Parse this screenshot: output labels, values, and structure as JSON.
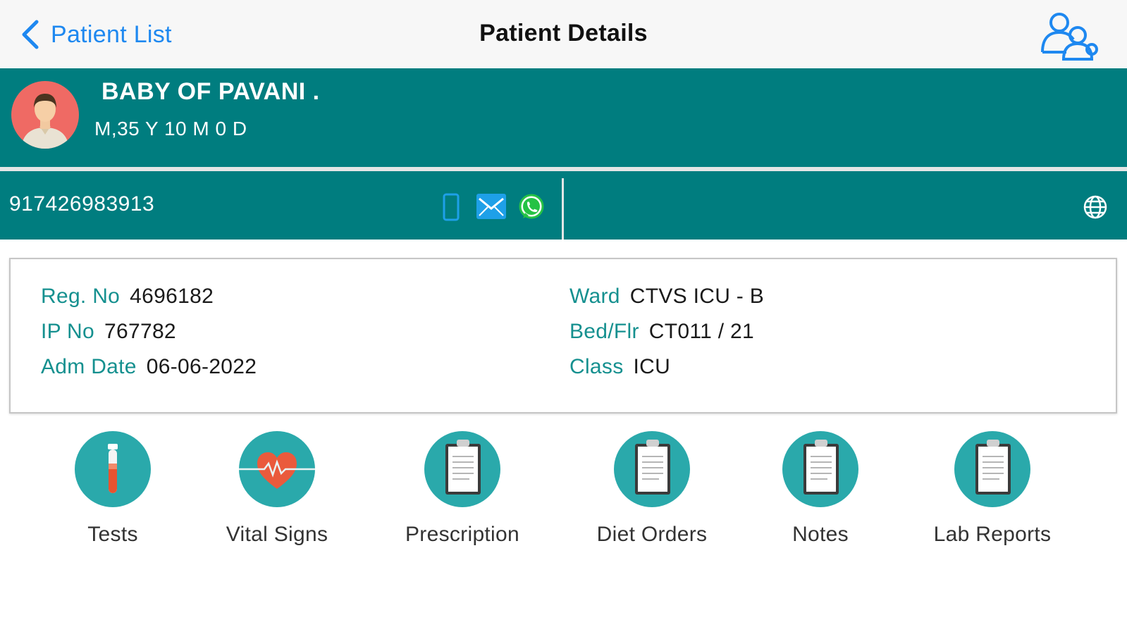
{
  "nav": {
    "back_label": "Patient List",
    "title": "Patient Details",
    "users_icon": "users-icon"
  },
  "patient": {
    "name": "BABY OF PAVANI  .",
    "age_sex": "M,35 Y 10 M 0 D",
    "avatar_icon": "person-avatar"
  },
  "contact": {
    "phone": "917426983913",
    "icons": [
      "mobile-icon",
      "email-icon",
      "whatsapp-icon",
      "globe-icon"
    ]
  },
  "details": {
    "reg_no_label": "Reg. No",
    "reg_no": "4696182",
    "ip_no_label": "IP No",
    "ip_no": "767782",
    "adm_date_label": "Adm Date",
    "adm_date": "06-06-2022",
    "ward_label": "Ward",
    "ward": "CTVS ICU - B",
    "bed_label": "Bed/Flr",
    "bed": "CT011 / 21",
    "class_label": "Class",
    "class": "ICU"
  },
  "actions": [
    {
      "label": "Tests",
      "icon": "test-tube-icon"
    },
    {
      "label": "Vital Signs",
      "icon": "heart-pulse-icon"
    },
    {
      "label": "Prescription",
      "icon": "clipboard-icon"
    },
    {
      "label": "Diet Orders",
      "icon": "clipboard-icon"
    },
    {
      "label": "Notes",
      "icon": "clipboard-icon"
    },
    {
      "label": "Lab Reports",
      "icon": "clipboard-icon"
    }
  ],
  "colors": {
    "teal_header": "#007d7f",
    "teal_label": "#15908f",
    "icon_circle": "#2aa9ab",
    "link_blue": "#1e88f0",
    "avatar_bg": "#ef6a64"
  }
}
